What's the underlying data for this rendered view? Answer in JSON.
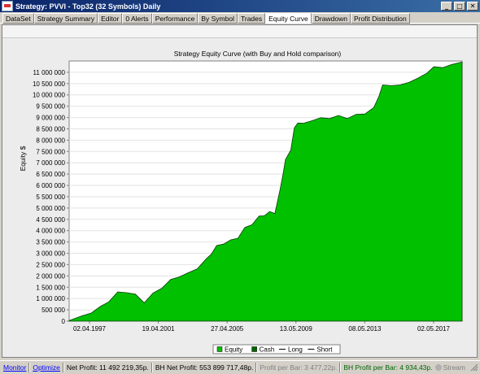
{
  "window": {
    "title": "Strategy: PVVI - Top32 (32 Symbols) Daily",
    "buttons": [
      "_",
      "□",
      "✕"
    ]
  },
  "tabs": [
    {
      "label": "DataSet",
      "active": false
    },
    {
      "label": "Strategy Summary",
      "active": false
    },
    {
      "label": "Editor",
      "active": false
    },
    {
      "label": "0 Alerts",
      "active": false
    },
    {
      "label": "Performance",
      "active": false
    },
    {
      "label": "By Symbol",
      "active": false
    },
    {
      "label": "Trades",
      "active": false
    },
    {
      "label": "Equity Curve",
      "active": true
    },
    {
      "label": "Drawdown",
      "active": false
    },
    {
      "label": "Profit Distribution",
      "active": false
    }
  ],
  "chart_data": {
    "type": "area",
    "title": "Strategy Equity Curve (with Buy and Hold comparison)",
    "ylabel": "Equity $",
    "xlabel": "",
    "ylim": [
      0,
      11500000
    ],
    "yticks": [
      0,
      500000,
      1000000,
      1500000,
      2000000,
      2500000,
      3000000,
      3500000,
      4000000,
      4500000,
      5000000,
      5500000,
      6000000,
      6500000,
      7000000,
      7500000,
      8000000,
      8500000,
      9000000,
      9500000,
      10000000,
      10500000,
      11000000
    ],
    "ytick_labels": [
      "0",
      "500 000",
      "1 000 000",
      "1 500 000",
      "2 000 000",
      "2 500 000",
      "3 000 000",
      "3 500 000",
      "4 000 000",
      "4 500 000",
      "5 000 000",
      "5 500 000",
      "6 000 000",
      "6 500 000",
      "7 000 000",
      "7 500 000",
      "8 000 000",
      "8 500 000",
      "9 000 000",
      "9 500 000",
      "10 000 000",
      "10 500 000",
      "11 000 000"
    ],
    "xtick_labels": [
      "02.04.1997",
      "19.04.2001",
      "27.04.2005",
      "13.05.2009",
      "08.05.2013",
      "02.05.2017"
    ],
    "grid": true,
    "legend_position": "bottom",
    "legend": [
      {
        "label": "Equity",
        "color": "#00c000",
        "kind": "box"
      },
      {
        "label": "Cash",
        "color": "#006400",
        "kind": "box"
      },
      {
        "label": "Long",
        "color": "#000000",
        "kind": "line"
      },
      {
        "label": "Short",
        "color": "#000000",
        "kind": "line"
      }
    ],
    "series": [
      {
        "name": "Equity",
        "color": "#00c000",
        "x": [
          1997.25,
          1998.0,
          1998.5,
          1999.0,
          1999.5,
          2000.0,
          2000.5,
          2001.0,
          2001.5,
          2002.0,
          2002.5,
          2003.0,
          2003.5,
          2004.0,
          2004.5,
          2005.0,
          2005.3,
          2005.6,
          2006.0,
          2006.4,
          2006.8,
          2007.2,
          2007.6,
          2008.0,
          2008.3,
          2008.6,
          2008.9,
          2009.2,
          2009.35,
          2009.5,
          2009.8,
          2010.0,
          2010.2,
          2010.5,
          2011.0,
          2011.5,
          2012.0,
          2012.5,
          2013.0,
          2013.5,
          2014.0,
          2014.5,
          2014.8,
          2015.0,
          2015.5,
          2016.0,
          2016.5,
          2017.0,
          2017.5,
          2017.9,
          2018.4,
          2018.9,
          2019.5
        ],
        "values": [
          70000,
          200000,
          400000,
          600000,
          900000,
          1250000,
          1300000,
          1150000,
          850000,
          1200000,
          1500000,
          1800000,
          2000000,
          2100000,
          2350000,
          2700000,
          3000000,
          3300000,
          3450000,
          3550000,
          3700000,
          4100000,
          4300000,
          4600000,
          4700000,
          4800000,
          4800000,
          5800000,
          6500000,
          7100000,
          7600000,
          8500000,
          8800000,
          8700000,
          8900000,
          8950000,
          9000000,
          9050000,
          9000000,
          9100000,
          9200000,
          9400000,
          10000000,
          10400000,
          10450000,
          10400000,
          10600000,
          10700000,
          11000000,
          11200000,
          11250000,
          11300000,
          11500000
        ]
      }
    ]
  },
  "status": {
    "monitor": "Monitor",
    "optimize": "Optimize",
    "net_profit": "Net Profit: 11 492 219,35р.",
    "bh_net_profit": "BH Net Profit: 553 899 717,48р.",
    "profit_per_bar": "Profit per Bar: 3 477,22р.",
    "bh_profit_per_bar": "BH Profit per Bar: 4 934,43р.",
    "stream": "Stream"
  }
}
